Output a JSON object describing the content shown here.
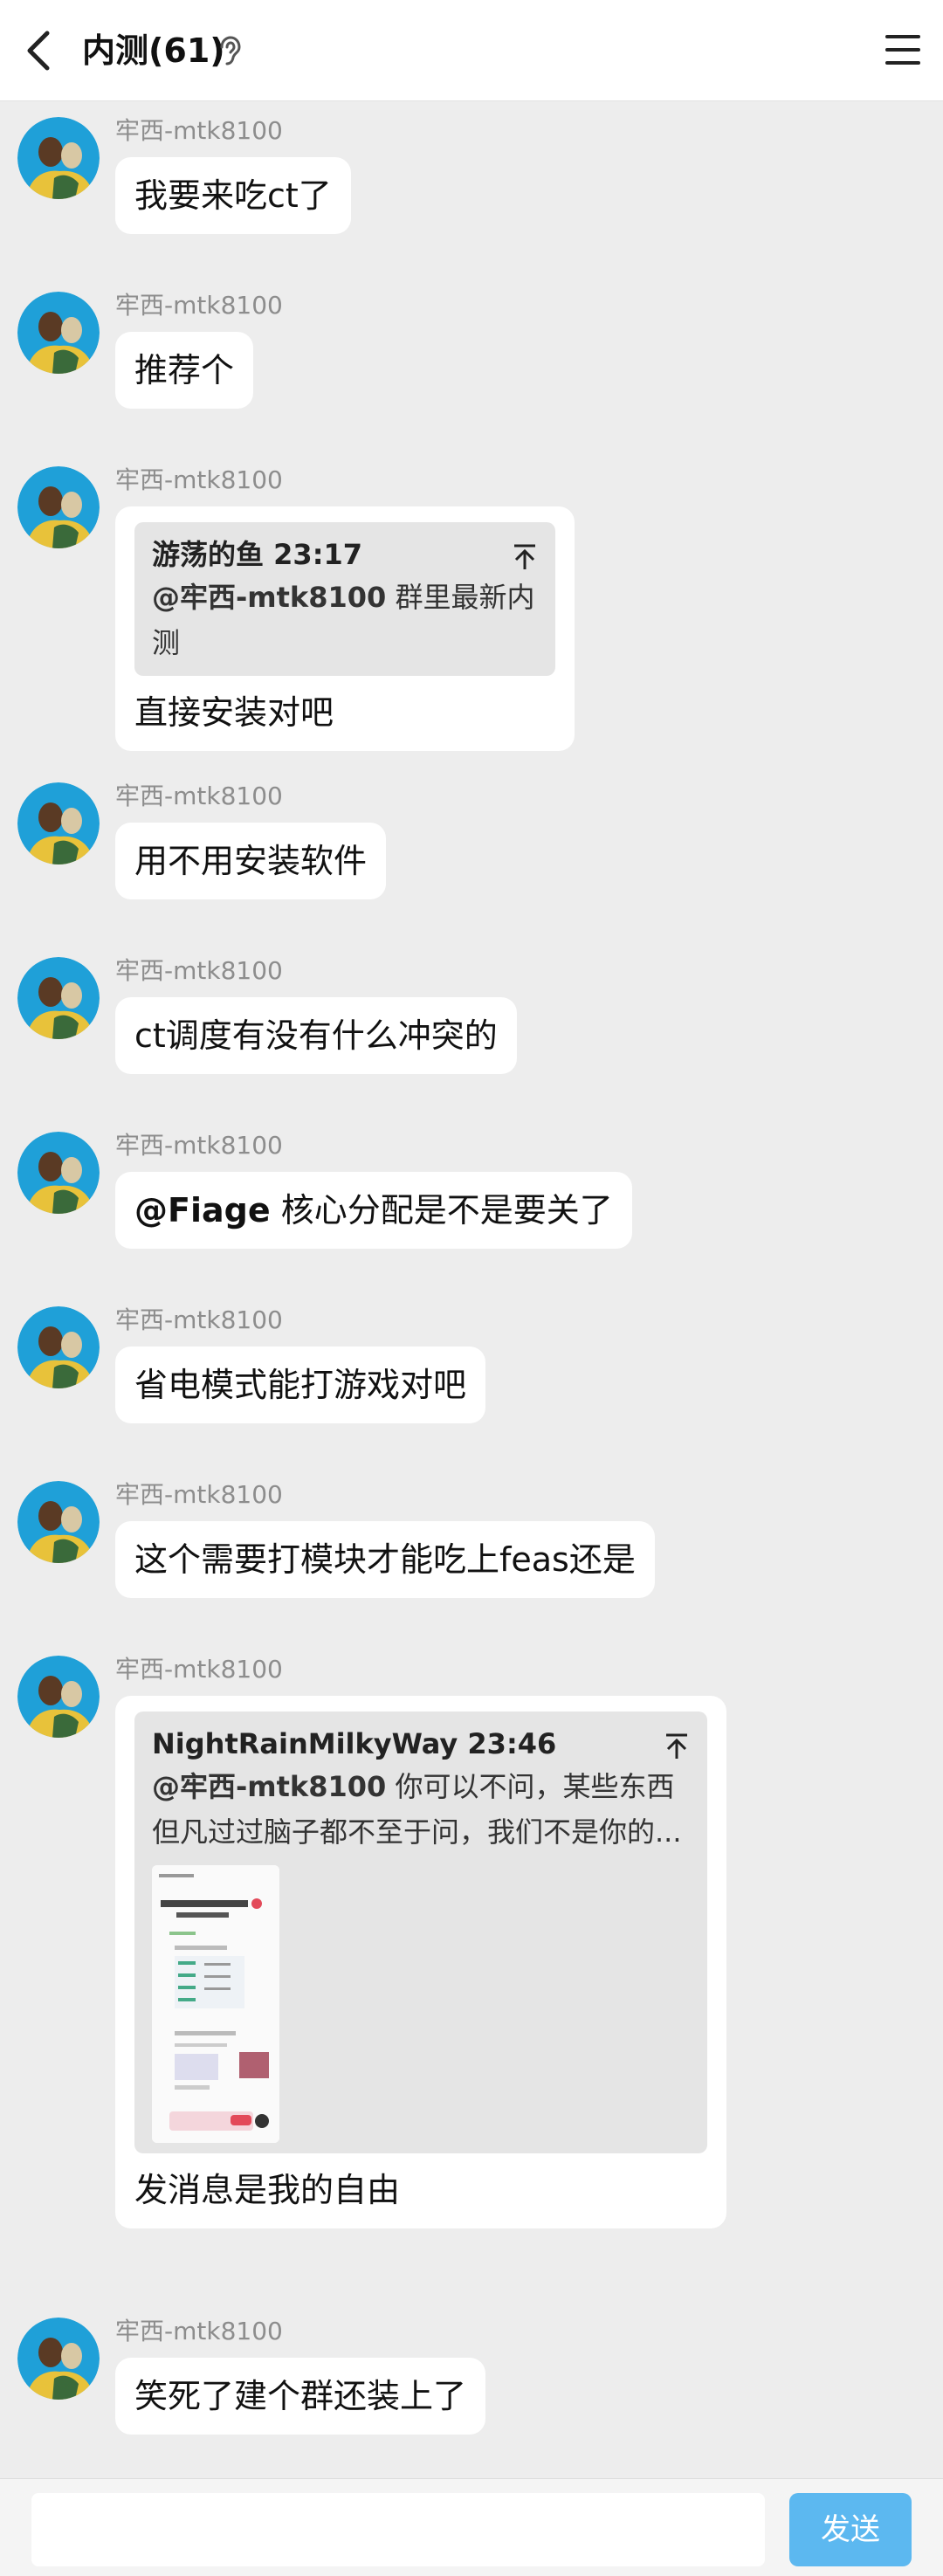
{
  "header": {
    "back_icon": "chevron-left-icon",
    "title": "内测",
    "count": "(61)",
    "ear_icon": "ear-icon",
    "menu_icon": "menu-icon"
  },
  "messages": [
    {
      "sender": "牢西-mtk8100",
      "text": "我要来吃ct了"
    },
    {
      "sender": "牢西-mtk8100",
      "text": "推荐个"
    },
    {
      "sender": "牢西-mtk8100",
      "quote": {
        "name": "游荡的鱼",
        "time": "23:17",
        "mention": "@牢西-mtk8100",
        "text": " 群里最新内测"
      },
      "text": "直接安装对吧"
    },
    {
      "sender": "牢西-mtk8100",
      "text": "用不用安装软件"
    },
    {
      "sender": "牢西-mtk8100",
      "text": "ct调度有没有什么冲突的"
    },
    {
      "sender": "牢西-mtk8100",
      "mention": "@Fiage",
      "text": " 核心分配是不是要关了"
    },
    {
      "sender": "牢西-mtk8100",
      "text": "省电模式能打游戏对吧"
    },
    {
      "sender": "牢西-mtk8100",
      "text": "这个需要打模块才能吃上feas还是"
    },
    {
      "sender": "牢西-mtk8100",
      "quote": {
        "name": "NightRainMilkyWay",
        "time": "23:46",
        "mention": "@牢西-mtk8100",
        "text": " 你可以不问，某些东西但凡过过脑子都不至于问，我们不是你的..."
      },
      "text": "发消息是我的自由"
    },
    {
      "sender": "牢西-mtk8100",
      "text": "笑死了建个群还装上了"
    }
  ],
  "input": {
    "value": "",
    "placeholder": "",
    "send_label": "发送"
  },
  "colors": {
    "background": "#ededed",
    "bubble": "#ffffff",
    "quote_bg": "#e5e5e5",
    "send_button": "#5cb8f0"
  }
}
